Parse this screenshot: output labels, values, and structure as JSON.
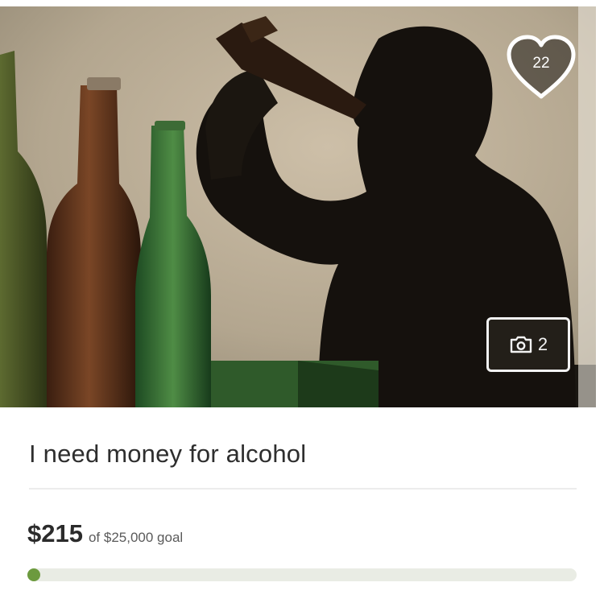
{
  "campaign": {
    "title": "I need money for alcohol",
    "hearts_count": "22",
    "photo_count": "2",
    "amount_raised": "$215",
    "goal_text": "of $25,000 goal",
    "progress_fraction": 0.0086,
    "accent_color": "#6c9a3e"
  },
  "icons": {
    "heart": "heart-icon",
    "camera": "camera-icon"
  }
}
